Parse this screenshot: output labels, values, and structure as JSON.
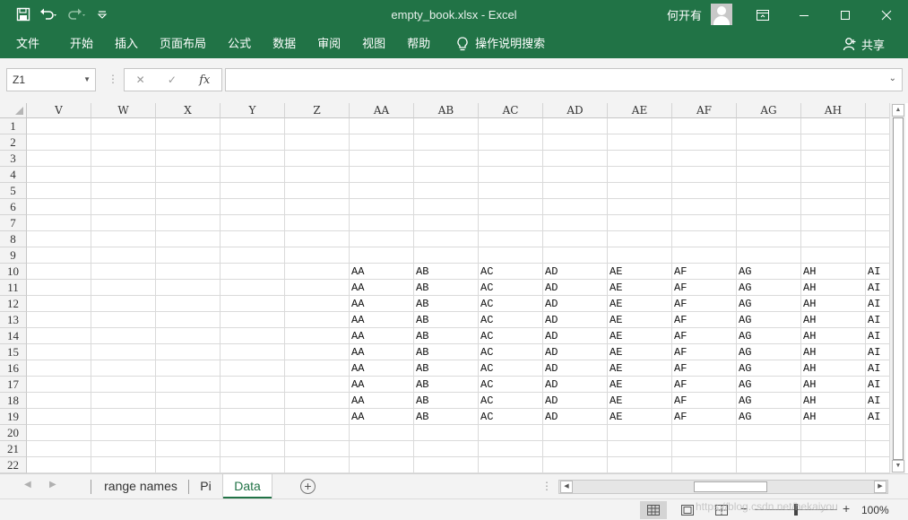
{
  "window": {
    "title": "empty_book.xlsx  -  Excel",
    "user_name": "何开有",
    "colors": {
      "brand": "#217346",
      "grid_line": "#dadada",
      "header_bg": "#f3f3f3"
    },
    "icons": [
      "save-icon",
      "undo-icon",
      "redo-icon",
      "customize-qat-icon",
      "ribbon-display-icon",
      "minimize-icon",
      "maximize-icon",
      "close-icon"
    ]
  },
  "ribbon": {
    "tabs": [
      "文件",
      "开始",
      "插入",
      "页面布局",
      "公式",
      "数据",
      "审阅",
      "视图",
      "帮助"
    ],
    "search_label": "操作说明搜索",
    "share_label": "共享"
  },
  "formula_bar": {
    "name_box": "Z1",
    "fx_label": "fx",
    "formula_value": ""
  },
  "grid": {
    "columns": [
      "V",
      "W",
      "X",
      "Y",
      "Z",
      "AA",
      "AB",
      "AC",
      "AD",
      "AE",
      "AF",
      "AG",
      "AH",
      "AI"
    ],
    "rows": [
      "1",
      "2",
      "3",
      "4",
      "5",
      "6",
      "7",
      "8",
      "9",
      "10",
      "11",
      "12",
      "13",
      "14",
      "15",
      "16",
      "17",
      "18",
      "19",
      "20",
      "21",
      "22"
    ],
    "data_rows": [
      "10",
      "11",
      "12",
      "13",
      "14",
      "15",
      "16",
      "17",
      "18",
      "19"
    ],
    "data_columns": [
      "AA",
      "AB",
      "AC",
      "AD",
      "AE",
      "AF",
      "AG",
      "AH",
      "AI"
    ],
    "data_values": [
      "AA",
      "AB",
      "AC",
      "AD",
      "AE",
      "AF",
      "AG",
      "AH",
      "AI"
    ]
  },
  "sheets": {
    "tabs": [
      "range names",
      "Pi",
      "Data"
    ],
    "active": "Data"
  },
  "status": {
    "zoom": "100%",
    "watermark": "https://blog.csdn.net/hekaiyou"
  }
}
